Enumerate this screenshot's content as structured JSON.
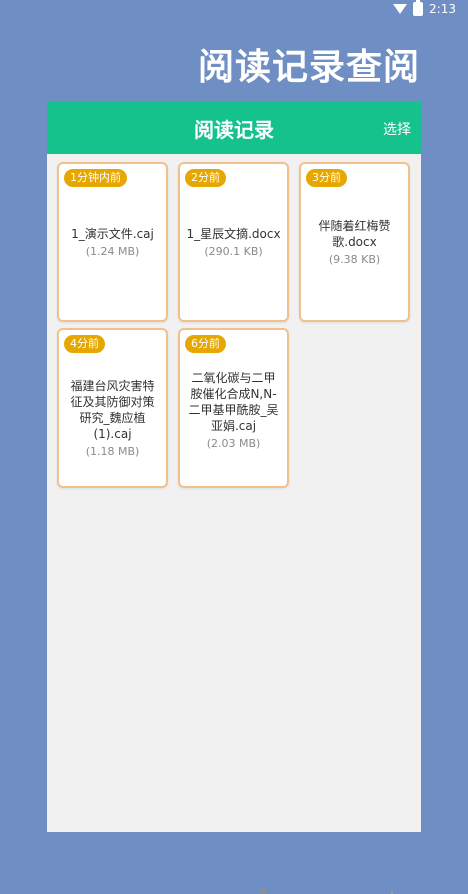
{
  "status_bar": {
    "time": "2:13"
  },
  "header": {
    "title": "阅读记录查阅"
  },
  "panel": {
    "title": "阅读记录",
    "select_label": "选择"
  },
  "cards": [
    {
      "badge": "1分钟内前",
      "title": "1_演示文件.caj",
      "size": "(1.24 MB)"
    },
    {
      "badge": "2分前",
      "title": "1_星辰文摘.docx",
      "size": "(290.1 KB)"
    },
    {
      "badge": "3分前",
      "title": "伴随着红梅赞歌.docx",
      "size": "(9.38 KB)"
    },
    {
      "badge": "4分前",
      "title": "福建台风灾害特征及其防御对策研究_魏应植(1).caj",
      "size": "(1.18 MB)"
    },
    {
      "badge": "6分前",
      "title": "二氧化碳与二甲胺催化合成N,N-二甲基甲酰胺_吴亚娟.caj",
      "size": "(2.03 MB)"
    }
  ]
}
